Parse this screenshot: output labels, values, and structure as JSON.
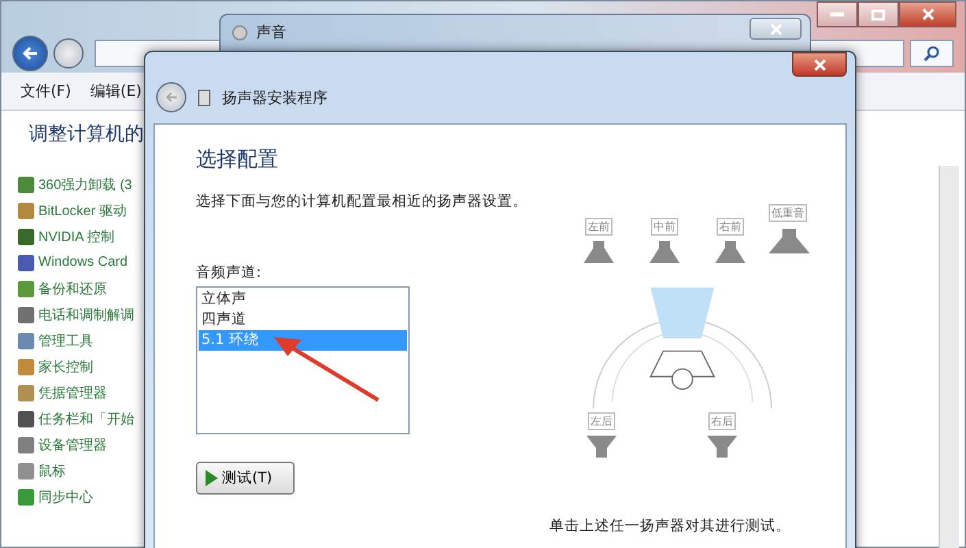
{
  "explorer": {
    "menu": [
      {
        "label": "文件(F)"
      },
      {
        "label": "编辑(E)"
      }
    ],
    "heading": "调整计算机的",
    "items": [
      {
        "label": "360强力卸载 (3",
        "color": "#4a8a3a"
      },
      {
        "label": "BitLocker 驱动",
        "color": "#b08a40"
      },
      {
        "label": "NVIDIA 控制",
        "color": "#3a6a2a"
      },
      {
        "label": "Windows Card",
        "color": "#4a5ab0"
      },
      {
        "label": "备份和还原",
        "color": "#5a9a3a"
      },
      {
        "label": "电话和调制解调",
        "color": "#707070"
      },
      {
        "label": "管理工具",
        "color": "#6a8ab0"
      },
      {
        "label": "家长控制",
        "color": "#c08a3a"
      },
      {
        "label": "凭据管理器",
        "color": "#b09050"
      },
      {
        "label": "任务栏和「开始",
        "color": "#505050"
      },
      {
        "label": "设备管理器",
        "color": "#808080"
      },
      {
        "label": "鼠标",
        "color": "#909090"
      },
      {
        "label": "同步中心",
        "color": "#3a9a3a"
      }
    ]
  },
  "sound_window": {
    "title": "声音"
  },
  "dialog": {
    "title": "扬声器安装程序",
    "heading": "选择配置",
    "description": "选择下面与您的计算机配置最相近的扬声器设置。",
    "channels_label": "音频声道:",
    "channels": [
      {
        "label": "立体声",
        "selected": false
      },
      {
        "label": "四声道",
        "selected": false
      },
      {
        "label": "5.1 环绕",
        "selected": true
      }
    ],
    "test_button": "测试(T)",
    "speakers": [
      {
        "label": "左前",
        "kind": "front"
      },
      {
        "label": "中前",
        "kind": "front"
      },
      {
        "label": "右前",
        "kind": "front"
      },
      {
        "label": "低重音",
        "kind": "subwoofer"
      },
      {
        "label": "左后",
        "kind": "rear"
      },
      {
        "label": "右后",
        "kind": "rear"
      }
    ],
    "hint": "单击上述任一扬声器对其进行测试。"
  }
}
